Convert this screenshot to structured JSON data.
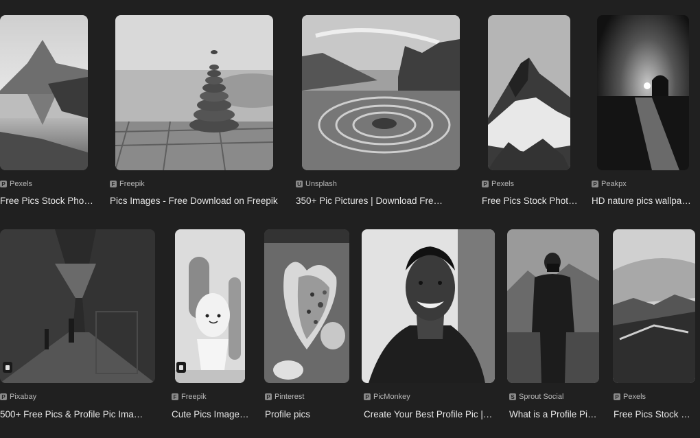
{
  "results": [
    {
      "source": "Pexels",
      "title": "Free Pics Stock Photos ...",
      "icon": "pexels-favicon-icon"
    },
    {
      "source": "Freepik",
      "title": "Pics Images - Free Download on Freepik",
      "icon": "freepik-favicon-icon"
    },
    {
      "source": "Unsplash",
      "title": "350+ Pic Pictures | Download Free ...",
      "icon": "unsplash-favicon-icon"
    },
    {
      "source": "Pexels",
      "title": "Free Pics Stock Photos ...",
      "icon": "pexels-favicon-icon"
    },
    {
      "source": "Peakpx",
      "title": "HD nature pics wallpaper ...",
      "icon": "peakpx-favicon-icon"
    },
    {
      "source": "Pixabay",
      "title": "500+ Free Pics & Profile Pic Images ...",
      "icon": "pixabay-favicon-icon"
    },
    {
      "source": "Freepik",
      "title": "Cute Pics Images - ...",
      "icon": "freepik-favicon-icon"
    },
    {
      "source": "Pinterest",
      "title": "Profile pics",
      "icon": "pinterest-favicon-icon"
    },
    {
      "source": "PicMonkey",
      "title": "Create Your Best Profile Pic | Ph...",
      "icon": "picmonkey-favicon-icon"
    },
    {
      "source": "Sprout Social",
      "title": "What is a Profile Pict...",
      "icon": "sproutsocial-favicon-icon"
    },
    {
      "source": "Pexels",
      "title": "Free Pics Stock Ph...",
      "icon": "pexels-favicon-icon"
    }
  ]
}
